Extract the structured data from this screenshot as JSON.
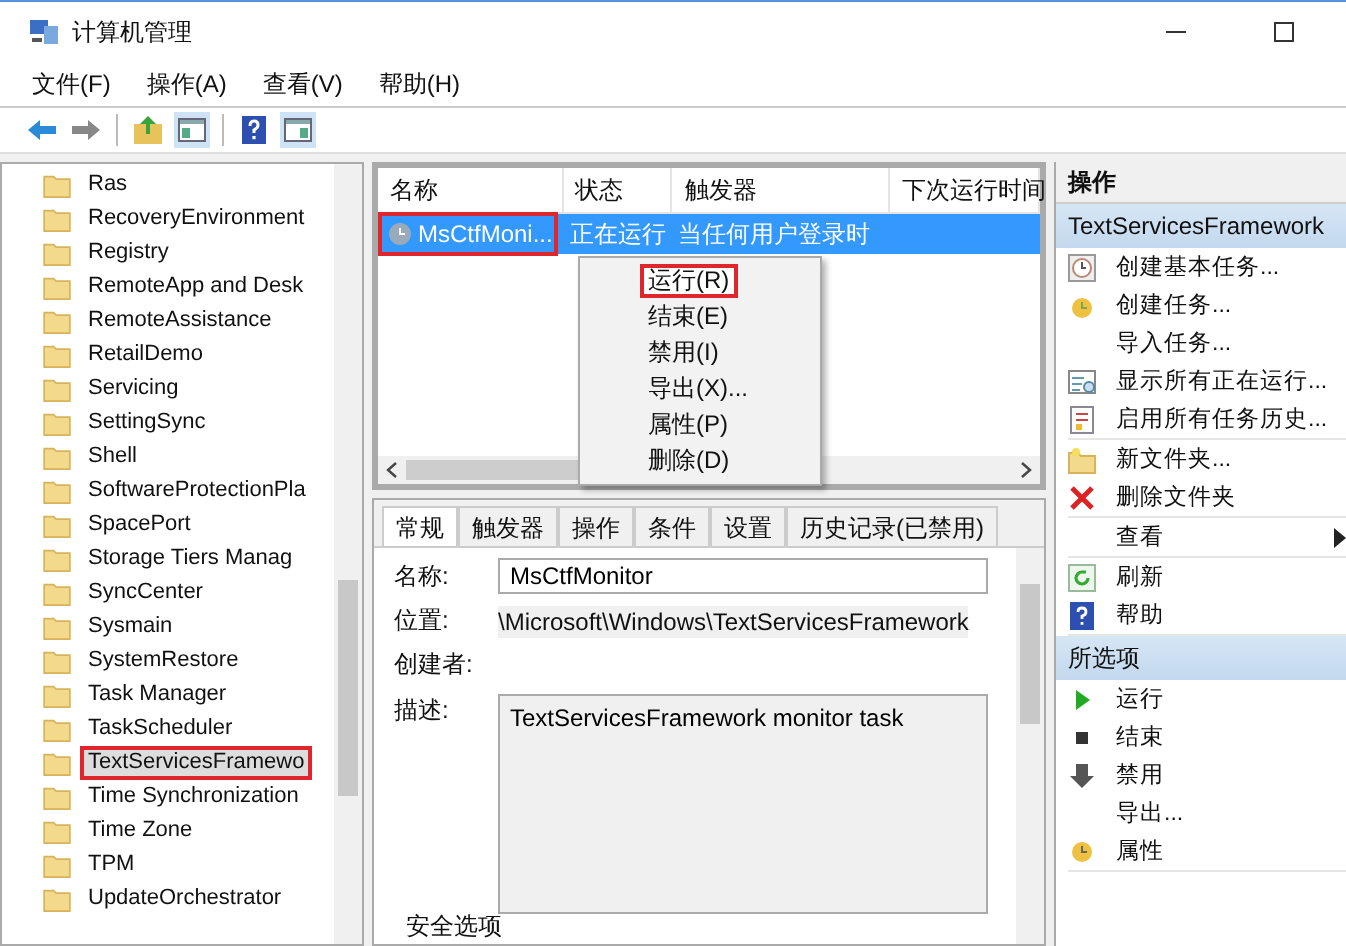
{
  "window": {
    "title": "计算机管理"
  },
  "menu": [
    "文件(F)",
    "操作(A)",
    "查看(V)",
    "帮助(H)"
  ],
  "tree": {
    "items": [
      {
        "label": "Ras",
        "highlighted": false
      },
      {
        "label": "RecoveryEnvironment",
        "highlighted": false
      },
      {
        "label": "Registry",
        "highlighted": false
      },
      {
        "label": "RemoteApp and Desk",
        "highlighted": false
      },
      {
        "label": "RemoteAssistance",
        "highlighted": false
      },
      {
        "label": "RetailDemo",
        "highlighted": false
      },
      {
        "label": "Servicing",
        "highlighted": false
      },
      {
        "label": "SettingSync",
        "highlighted": false
      },
      {
        "label": "Shell",
        "highlighted": false
      },
      {
        "label": "SoftwareProtectionPla",
        "highlighted": false
      },
      {
        "label": "SpacePort",
        "highlighted": false
      },
      {
        "label": "Storage Tiers Manag",
        "highlighted": false
      },
      {
        "label": "SyncCenter",
        "highlighted": false
      },
      {
        "label": "Sysmain",
        "highlighted": false
      },
      {
        "label": "SystemRestore",
        "highlighted": false
      },
      {
        "label": "Task Manager",
        "highlighted": false
      },
      {
        "label": "TaskScheduler",
        "highlighted": false
      },
      {
        "label": "TextServicesFramewo",
        "highlighted": true
      },
      {
        "label": "Time Synchronization",
        "highlighted": false
      },
      {
        "label": "Time Zone",
        "highlighted": false
      },
      {
        "label": "TPM",
        "highlighted": false
      },
      {
        "label": "UpdateOrchestrator",
        "highlighted": false
      }
    ]
  },
  "tasks": {
    "columns": [
      "名称",
      "状态",
      "触发器",
      "下次运行时间"
    ],
    "rows": [
      {
        "name": "MsCtfMoni...",
        "status": "正在运行",
        "trigger": "当任何用户登录时",
        "selected": true,
        "highlighted": true
      }
    ]
  },
  "context_menu": [
    {
      "label": "运行(R)",
      "highlighted": true
    },
    {
      "label": "结束(E)",
      "highlighted": false
    },
    {
      "label": "禁用(I)",
      "highlighted": false
    },
    {
      "label": "导出(X)...",
      "highlighted": false
    },
    {
      "label": "属性(P)",
      "highlighted": false
    },
    {
      "label": "删除(D)",
      "highlighted": false
    }
  ],
  "details": {
    "tabs": [
      {
        "label": "常规",
        "selected": true
      },
      {
        "label": "触发器",
        "selected": false
      },
      {
        "label": "操作",
        "selected": false
      },
      {
        "label": "条件",
        "selected": false
      },
      {
        "label": "设置",
        "selected": false
      },
      {
        "label": "历史记录(已禁用)",
        "selected": false
      }
    ],
    "name_label": "名称:",
    "name_value": "MsCtfMonitor",
    "location_label": "位置:",
    "location_value": "\\Microsoft\\Windows\\TextServicesFramework",
    "author_label": "创建者:",
    "description_label": "描述:",
    "description_value": "TextServicesFramework monitor task",
    "security_label": "安全选项"
  },
  "actions": {
    "title": "操作",
    "sections": [
      {
        "title": "TextServicesFramework",
        "groups": [
          [
            {
              "label": "创建基本任务...",
              "kind": "item"
            },
            {
              "label": "创建任务...",
              "kind": "item"
            },
            {
              "label": "导入任务...",
              "kind": "item"
            },
            {
              "label": "显示所有正在运行...",
              "kind": "item"
            },
            {
              "label": "启用所有任务历史...",
              "kind": "item"
            }
          ],
          [
            {
              "label": "新文件夹...",
              "kind": "item"
            },
            {
              "label": "删除文件夹",
              "kind": "item"
            }
          ],
          [
            {
              "label": "查看",
              "kind": "submenu"
            }
          ],
          [
            {
              "label": "刷新",
              "kind": "item"
            },
            {
              "label": "帮助",
              "kind": "item"
            }
          ]
        ]
      },
      {
        "title": "所选项",
        "groups": [
          [
            {
              "label": "运行",
              "kind": "item"
            },
            {
              "label": "结束",
              "kind": "item"
            },
            {
              "label": "禁用",
              "kind": "item"
            },
            {
              "label": "导出...",
              "kind": "item"
            },
            {
              "label": "属性",
              "kind": "item"
            }
          ]
        ]
      }
    ]
  }
}
